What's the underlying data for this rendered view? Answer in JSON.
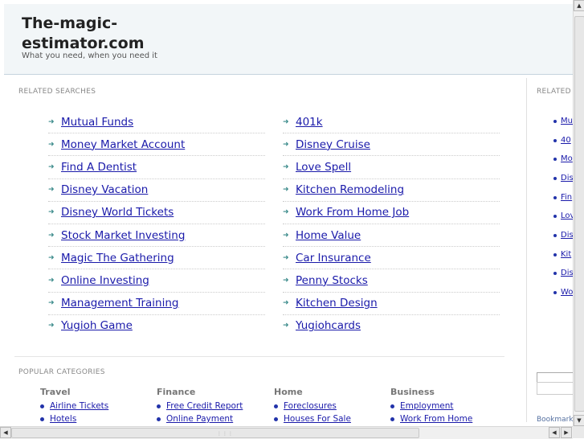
{
  "header": {
    "title_line1": "The-magic-",
    "title_line2": "estimator.com",
    "tagline": "What you need, when you need it"
  },
  "related_searches": {
    "label": "RELATED SEARCHES",
    "left": [
      "Mutual Funds",
      "Money Market Account",
      "Find A Dentist",
      "Disney Vacation",
      "Disney World Tickets",
      "Stock Market Investing",
      "Magic The Gathering",
      "Online Investing",
      "Management Training",
      "Yugioh Game"
    ],
    "right": [
      "401k",
      "Disney Cruise",
      "Love Spell",
      "Kitchen Remodeling",
      "Work From Home Job",
      "Home Value",
      "Car Insurance",
      "Penny Stocks",
      "Kitchen Design",
      "Yugiohcards"
    ]
  },
  "popular_categories": {
    "label": "POPULAR CATEGORIES",
    "groups": [
      {
        "title": "Travel",
        "items": [
          "Airline Tickets",
          "Hotels"
        ]
      },
      {
        "title": "Finance",
        "items": [
          "Free Credit Report",
          "Online Payment"
        ]
      },
      {
        "title": "Home",
        "items": [
          "Foreclosures",
          "Houses For Sale"
        ]
      },
      {
        "title": "Business",
        "items": [
          "Employment",
          "Work From Home"
        ]
      }
    ]
  },
  "right_panel": {
    "label": "RELATED",
    "items": [
      "Mu",
      "40",
      "Mo",
      "Dis",
      "Fin",
      "Lov",
      "Dis",
      "Kit",
      "Dis",
      "Wo"
    ],
    "bookmark": "Bookmark"
  },
  "icons": {
    "arrow": "arrow-right-icon",
    "bullet": "bullet-icon"
  }
}
